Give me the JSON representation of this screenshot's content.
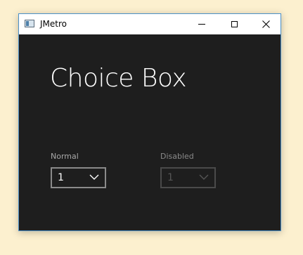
{
  "window": {
    "title": "JMetro",
    "controls": {
      "minimize": "minimize-icon",
      "maximize": "maximize-icon",
      "close": "close-icon"
    }
  },
  "main": {
    "title": "Choice Box",
    "normal": {
      "label": "Normal",
      "value": "1"
    },
    "disabled": {
      "label": "Disabled",
      "value": "1"
    }
  },
  "colors": {
    "page_background": "#fcf0cf",
    "content_background": "#1e1e1e",
    "title_text": "#ffffff",
    "choice_border": "#8a8a8a",
    "disabled_border": "#4a4a4a",
    "window_border": "#4a90c8"
  }
}
